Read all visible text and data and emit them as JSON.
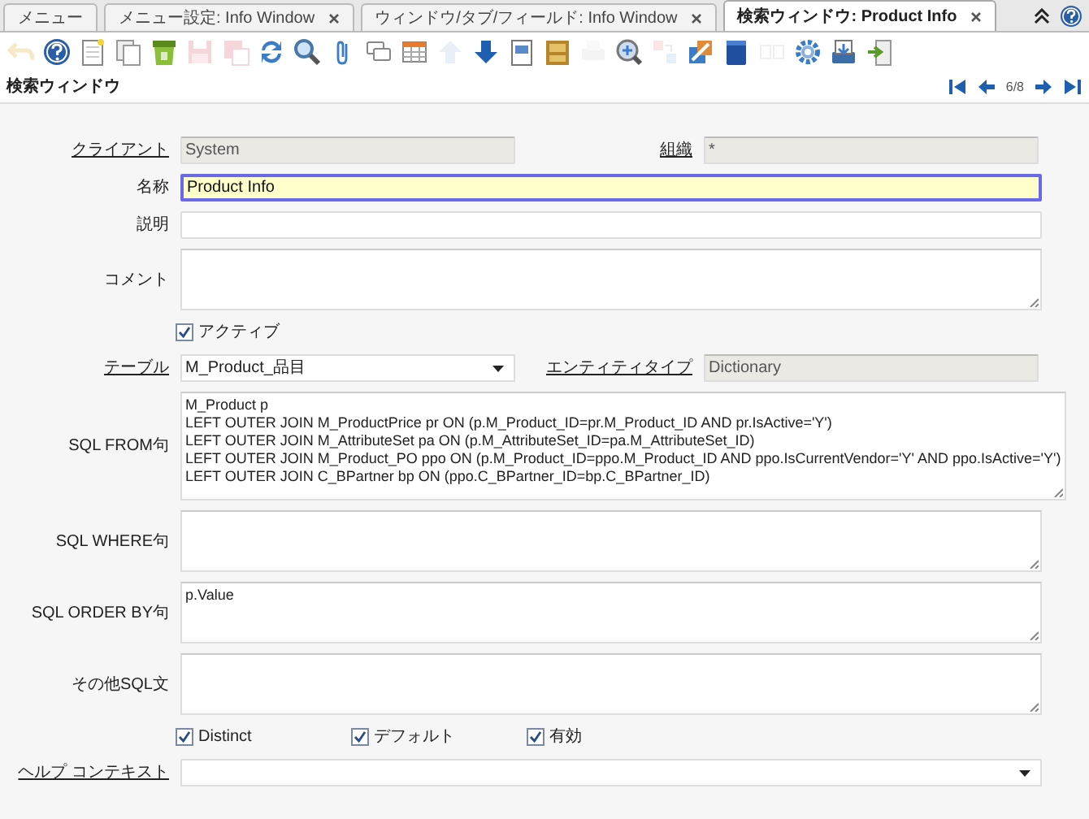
{
  "tabs": [
    {
      "label": "メニュー",
      "selected": false,
      "closable": false
    },
    {
      "label": "メニュー設定: Info Window",
      "selected": false,
      "closable": true
    },
    {
      "label": "ウィンドウ/タブ/フィールド: Info Window",
      "selected": false,
      "closable": true
    },
    {
      "label": "検索ウィンドウ: Product Info",
      "selected": true,
      "closable": true
    }
  ],
  "toolbar": [
    {
      "disabled": true
    },
    {
      "disabled": false
    },
    {
      "disabled": false
    },
    {
      "disabled": false
    },
    {
      "disabled": false
    },
    {
      "disabled": true
    },
    {
      "disabled": true
    },
    {
      "disabled": false
    },
    {
      "disabled": false
    },
    {
      "disabled": false
    },
    {
      "disabled": false
    },
    {
      "disabled": false
    },
    {
      "disabled": true
    },
    {
      "disabled": false
    },
    {
      "disabled": false
    },
    {
      "disabled": false
    },
    {
      "disabled": true
    },
    {
      "disabled": false
    },
    {
      "disabled": true
    },
    {
      "disabled": false
    },
    {
      "disabled": false
    },
    {
      "disabled": true
    },
    {
      "disabled": false
    },
    {
      "disabled": false
    },
    {
      "disabled": false
    }
  ],
  "header": {
    "title": "検索ウィンドウ",
    "record": "6/8"
  },
  "form": {
    "rows": [
      {
        "fields": [
          {
            "kind": "text",
            "label": "クライアント",
            "link": true,
            "value": "System",
            "readonly": true,
            "focused": false
          },
          {
            "kind": "text",
            "label": "組織",
            "link": true,
            "value": "*",
            "readonly": true,
            "focused": false
          }
        ]
      },
      {
        "fields": [
          {
            "kind": "text",
            "label": "名称",
            "link": false,
            "value": "Product Info",
            "readonly": false,
            "focused": true
          }
        ]
      },
      {
        "fields": [
          {
            "kind": "text",
            "label": "説明",
            "link": false,
            "readonly": false,
            "focused": false
          }
        ]
      },
      {
        "fields": [
          {
            "kind": "textarea",
            "label": "コメント",
            "link": false
          }
        ]
      },
      {
        "fields": [
          {
            "kind": "checkbox",
            "label": "アクティブ",
            "checked": true
          }
        ]
      },
      {
        "fields": [
          {
            "kind": "select",
            "label": "テーブル",
            "link": true,
            "value": "M_Product_品目"
          },
          {
            "kind": "text",
            "label": "エンティティタイプ",
            "link": true,
            "value": "Dictionary",
            "readonly": true,
            "focused": false
          }
        ]
      },
      {
        "fields": [
          {
            "kind": "textarea",
            "label": "SQL FROM句",
            "link": false,
            "lines": [
              "M_Product p",
              "LEFT OUTER JOIN M_ProductPrice pr ON (p.M_Product_ID=pr.M_Product_ID AND pr.IsActive='Y')",
              "LEFT OUTER JOIN M_AttributeSet pa ON (p.M_AttributeSet_ID=pa.M_AttributeSet_ID)",
              "LEFT OUTER JOIN M_Product_PO ppo ON (p.M_Product_ID=ppo.M_Product_ID AND ppo.IsCurrentVendor='Y' AND ppo.IsActive='Y')",
              "LEFT OUTER JOIN C_BPartner bp ON (ppo.C_BPartner_ID=bp.C_BPartner_ID)"
            ]
          }
        ]
      },
      {
        "fields": [
          {
            "kind": "textarea",
            "label": "SQL WHERE句",
            "link": false
          }
        ]
      },
      {
        "fields": [
          {
            "kind": "textarea",
            "label": "SQL ORDER BY句",
            "link": false,
            "lines": [
              "p.Value"
            ]
          }
        ]
      },
      {
        "fields": [
          {
            "kind": "textarea",
            "label": "その他SQL文",
            "link": false
          }
        ]
      },
      {
        "fields": [
          {
            "kind": "checkbox",
            "label": "Distinct",
            "checked": true
          },
          {
            "kind": "checkbox",
            "label": "デフォルト",
            "checked": true
          },
          {
            "kind": "checkbox",
            "label": "有効",
            "checked": true
          }
        ]
      },
      {
        "fields": [
          {
            "kind": "select",
            "label": "ヘルプ コンテキスト",
            "link": true
          }
        ]
      }
    ]
  }
}
